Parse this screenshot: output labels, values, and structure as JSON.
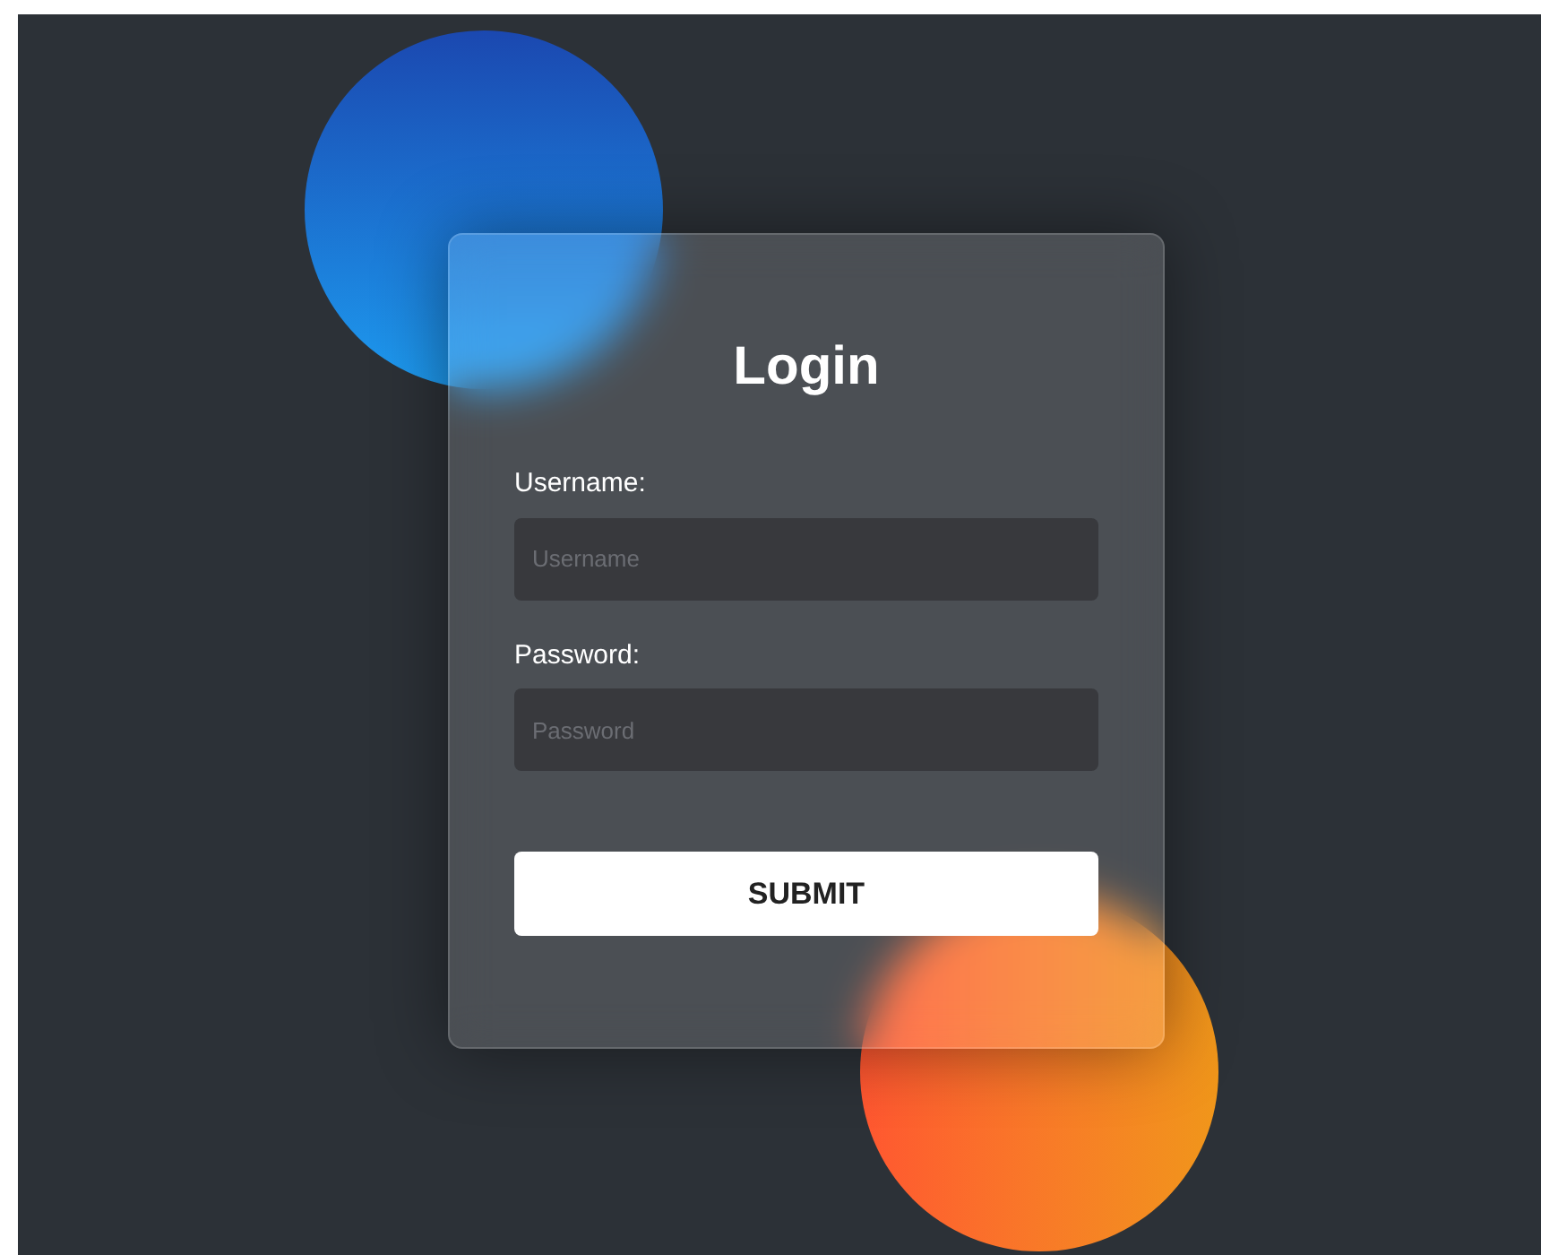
{
  "form": {
    "title": "Login",
    "fields": [
      {
        "label": "Username:",
        "placeholder": "Username"
      },
      {
        "label": "Password:",
        "placeholder": "Password"
      }
    ],
    "submit": "SUBMIT"
  }
}
